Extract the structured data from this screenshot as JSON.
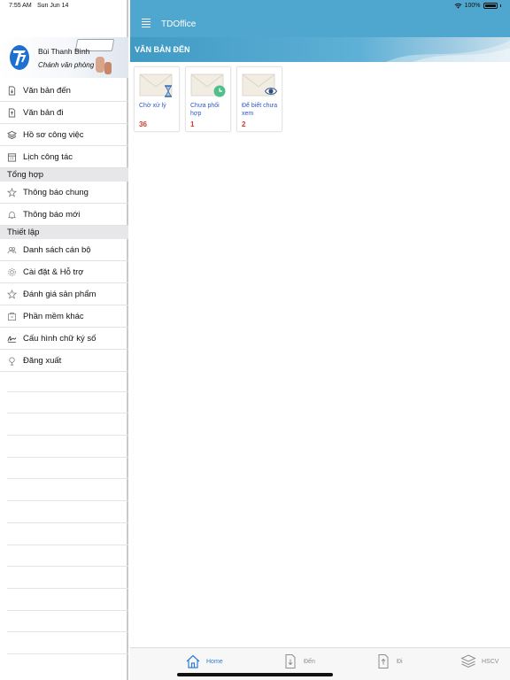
{
  "status_bar": {
    "time": "7:55 AM",
    "date": "Sun Jun 14",
    "battery": "100%"
  },
  "profile": {
    "name": "Bùi Thanh Bình",
    "role": "Chánh văn phòng"
  },
  "sidebar": {
    "items_top": [
      {
        "label": "Văn bản đến",
        "icon": "document-in-icon"
      },
      {
        "label": "Văn bản đi",
        "icon": "document-out-icon"
      },
      {
        "label": "Hồ sơ công việc",
        "icon": "layers-icon"
      },
      {
        "label": "Lịch công tác",
        "icon": "calendar-icon"
      }
    ],
    "section_summary": "Tổng hợp",
    "items_summary": [
      {
        "label": "Thông báo chung",
        "icon": "star-burst-icon"
      },
      {
        "label": "Thông báo mới",
        "icon": "bell-icon"
      }
    ],
    "section_settings": "Thiết lập",
    "items_settings": [
      {
        "label": "Danh sách cán bộ",
        "icon": "users-icon"
      },
      {
        "label": "Cài đặt & Hỗ trợ",
        "icon": "gear-icon"
      },
      {
        "label": "Đánh giá sản phẩm",
        "icon": "star-icon"
      },
      {
        "label": "Phần mềm khác",
        "icon": "app-icon"
      },
      {
        "label": "Cấu hình chữ ký số",
        "icon": "signature-icon"
      },
      {
        "label": "Đăng xuất",
        "icon": "logout-icon"
      }
    ]
  },
  "header": {
    "title": "TDOffice"
  },
  "banner": {
    "title": "VĂN BẢN ĐẾN"
  },
  "cards": [
    {
      "label": "Chờ xử lý",
      "count": "36",
      "badge": "hourglass-icon"
    },
    {
      "label": "Chưa phối hợp",
      "count": "1",
      "badge": "clock-icon"
    },
    {
      "label": "Để biết chưa xem",
      "count": "2",
      "badge": "eye-icon"
    }
  ],
  "tabbar": {
    "home": "Home",
    "incoming": "Đến",
    "outgoing": "Đi",
    "hscv": "HSCV"
  },
  "colors": {
    "header": "#4fa7cf",
    "active_tab": "#2d7fd3",
    "count": "#d43a2a",
    "card_label": "#2f56c8"
  }
}
